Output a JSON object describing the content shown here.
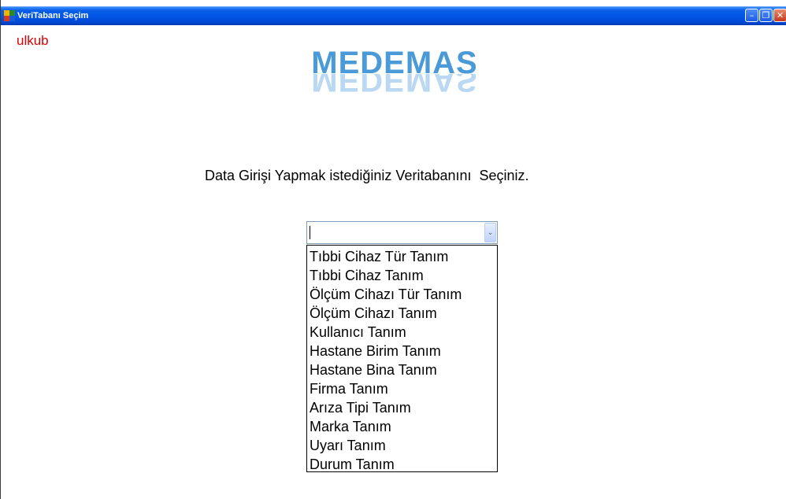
{
  "window": {
    "title": "VeriTabanı Seçim",
    "min_glyph": "–",
    "max_glyph": "❐",
    "close_glyph": "✕"
  },
  "user": {
    "name": "ulkub"
  },
  "logo": {
    "text": "MEDEMAS"
  },
  "instruction": {
    "text": "Data Girişi Yapmak istediğiniz Veritabanını  Seçiniz."
  },
  "combo": {
    "value": "",
    "arrow": "⌄"
  },
  "dropdown": {
    "items": [
      "Tıbbi Cihaz Tür Tanım",
      "Tıbbi Cihaz Tanım",
      "Ölçüm Cihazı Tür Tanım",
      "Ölçüm Cihazı Tanım",
      "Kullanıcı Tanım",
      "Hastane Birim Tanım",
      "Hastane Bina Tanım",
      "Firma Tanım",
      "Arıza Tipi Tanım",
      "Marka Tanım",
      "Uyarı Tanım",
      "Durum Tanım"
    ]
  },
  "colors": {
    "titlebar": "#0055e5",
    "user_label": "#e00000",
    "logo": "#4a9ad8"
  }
}
